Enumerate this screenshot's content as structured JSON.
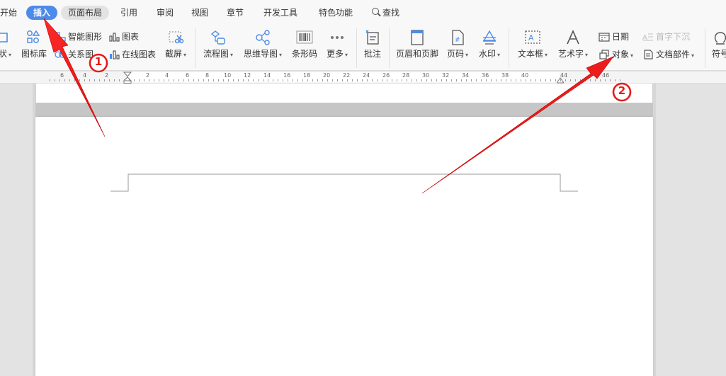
{
  "menu": {
    "tabs": [
      "开始",
      "插入",
      "页面布局",
      "引用",
      "审阅",
      "视图",
      "章节",
      "开发工具",
      "特色功能"
    ],
    "search": "查找"
  },
  "ribbon": {
    "partial_shape": "状",
    "icon_lib": "图标库",
    "smart_shape": "智能图形",
    "relation": "关系图",
    "chart": "图表",
    "online_chart": "在线图表",
    "screenshot": "截屏",
    "flowchart": "流程图",
    "mindmap": "思维导图",
    "barcode": "条形码",
    "more": "更多",
    "comment": "批注",
    "header_footer": "页眉和页脚",
    "page_num": "页码",
    "watermark": "水印",
    "textbox": "文本框",
    "wordart": "艺术字",
    "date": "日期",
    "object": "对象",
    "dropcap": "首字下沉",
    "doc_parts": "文档部件",
    "symbol": "符号"
  },
  "ruler": {
    "labels": [
      "6",
      "4",
      "2",
      "2",
      "4",
      "6",
      "8",
      "10",
      "12",
      "14",
      "16",
      "18",
      "20",
      "22",
      "24",
      "26",
      "28",
      "30",
      "32",
      "34",
      "36",
      "38",
      "40",
      "44",
      "46"
    ]
  },
  "annotations": {
    "step1": "1",
    "step2": "2"
  },
  "colors": {
    "accent": "#4c8bea",
    "arrow": "#ee1c1c"
  }
}
